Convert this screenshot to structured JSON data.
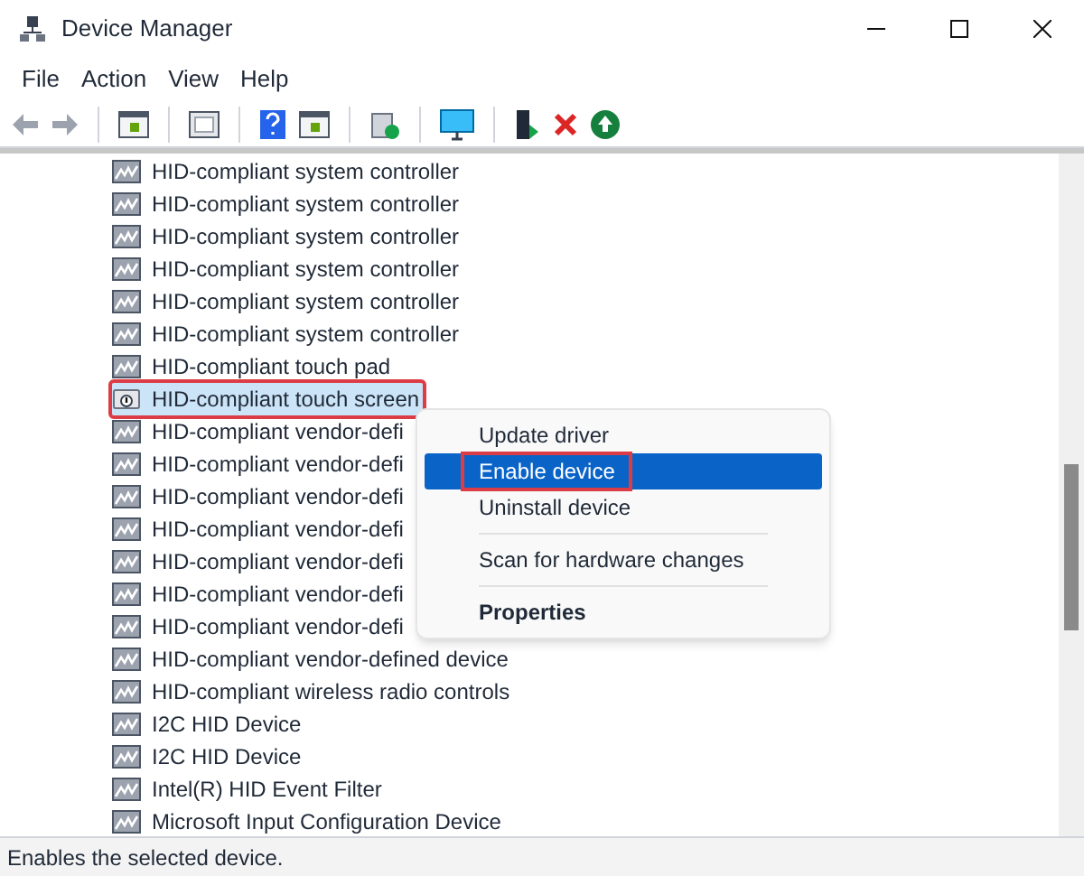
{
  "window": {
    "title": "Device Manager"
  },
  "menu_bar": [
    "File",
    "Action",
    "View",
    "Help"
  ],
  "toolbar": [
    {
      "kind": "back",
      "disabled": true
    },
    {
      "kind": "forward",
      "disabled": true
    },
    {
      "kind": "sep"
    },
    {
      "kind": "panel",
      "disabled": false
    },
    {
      "kind": "sep"
    },
    {
      "kind": "sheet",
      "disabled": false
    },
    {
      "kind": "sep"
    },
    {
      "kind": "help",
      "disabled": false
    },
    {
      "kind": "panel",
      "disabled": false
    },
    {
      "kind": "sep"
    },
    {
      "kind": "scan",
      "disabled": false
    },
    {
      "kind": "sep"
    },
    {
      "kind": "monitor",
      "disabled": false
    },
    {
      "kind": "sep"
    },
    {
      "kind": "update",
      "disabled": false
    },
    {
      "kind": "remove",
      "disabled": false
    },
    {
      "kind": "enable",
      "disabled": false
    }
  ],
  "tree": {
    "items": [
      {
        "label": "HID-compliant system controller",
        "selected": false,
        "outlined": false,
        "kind": "hid"
      },
      {
        "label": "HID-compliant system controller",
        "selected": false,
        "outlined": false,
        "kind": "hid"
      },
      {
        "label": "HID-compliant system controller",
        "selected": false,
        "outlined": false,
        "kind": "hid"
      },
      {
        "label": "HID-compliant system controller",
        "selected": false,
        "outlined": false,
        "kind": "hid"
      },
      {
        "label": "HID-compliant system controller",
        "selected": false,
        "outlined": false,
        "kind": "hid"
      },
      {
        "label": "HID-compliant system controller",
        "selected": false,
        "outlined": false,
        "kind": "hid"
      },
      {
        "label": "HID-compliant touch pad",
        "selected": false,
        "outlined": false,
        "kind": "hid"
      },
      {
        "label": "HID-compliant touch screen",
        "selected": true,
        "outlined": true,
        "kind": "disabled"
      },
      {
        "label": "HID-compliant vendor-defi",
        "selected": false,
        "outlined": false,
        "kind": "hid"
      },
      {
        "label": "HID-compliant vendor-defi",
        "selected": false,
        "outlined": false,
        "kind": "hid"
      },
      {
        "label": "HID-compliant vendor-defi",
        "selected": false,
        "outlined": false,
        "kind": "hid"
      },
      {
        "label": "HID-compliant vendor-defi",
        "selected": false,
        "outlined": false,
        "kind": "hid"
      },
      {
        "label": "HID-compliant vendor-defi",
        "selected": false,
        "outlined": false,
        "kind": "hid"
      },
      {
        "label": "HID-compliant vendor-defi",
        "selected": false,
        "outlined": false,
        "kind": "hid"
      },
      {
        "label": "HID-compliant vendor-defi",
        "selected": false,
        "outlined": false,
        "kind": "hid"
      },
      {
        "label": "HID-compliant vendor-defined device",
        "selected": false,
        "outlined": false,
        "kind": "hid"
      },
      {
        "label": "HID-compliant wireless radio controls",
        "selected": false,
        "outlined": false,
        "kind": "hid"
      },
      {
        "label": "I2C HID Device",
        "selected": false,
        "outlined": false,
        "kind": "hid"
      },
      {
        "label": "I2C HID Device",
        "selected": false,
        "outlined": false,
        "kind": "hid"
      },
      {
        "label": "Intel(R) HID Event Filter",
        "selected": false,
        "outlined": false,
        "kind": "hid"
      },
      {
        "label": "Microsoft Input Configuration Device",
        "selected": false,
        "outlined": false,
        "kind": "hid"
      }
    ]
  },
  "context_menu": [
    {
      "kind": "item",
      "label": "Update driver",
      "selected": false,
      "outlined": false,
      "bold": false
    },
    {
      "kind": "item",
      "label": "Enable device",
      "selected": true,
      "outlined": true,
      "bold": false
    },
    {
      "kind": "item",
      "label": "Uninstall device",
      "selected": false,
      "outlined": false,
      "bold": false
    },
    {
      "kind": "separator"
    },
    {
      "kind": "item",
      "label": "Scan for hardware changes",
      "selected": false,
      "outlined": false,
      "bold": false
    },
    {
      "kind": "separator"
    },
    {
      "kind": "item",
      "label": "Properties",
      "selected": false,
      "outlined": false,
      "bold": true
    }
  ],
  "status_bar": "Enables the selected device."
}
